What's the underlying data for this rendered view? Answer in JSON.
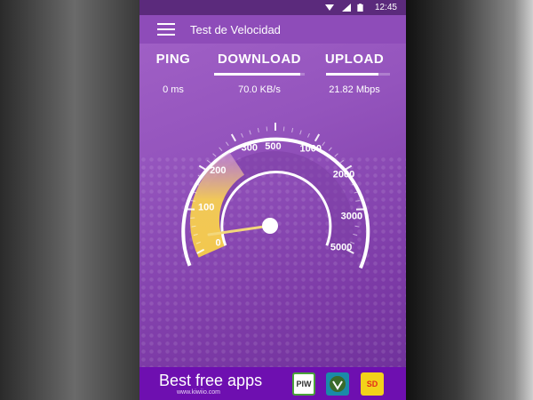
{
  "status_bar": {
    "time": "12:45",
    "icons": [
      "wifi-icon",
      "signal-icon",
      "battery-icon"
    ]
  },
  "app_bar": {
    "title": "Test de Velocidad",
    "menu_icon": "hamburger-menu-icon"
  },
  "tabs": [
    {
      "label": "PING",
      "value": "0 ms",
      "active": false
    },
    {
      "label": "DOWNLOAD",
      "value": "70.0 KB/s",
      "active": true,
      "progress": 0.95
    },
    {
      "label": "UPLOAD",
      "value": "21.82 Mbps",
      "active": true,
      "progress": 0.82
    }
  ],
  "gauge": {
    "ticks": [
      "0",
      "100",
      "200",
      "300",
      "500",
      "1000",
      "2000",
      "3000",
      "5000"
    ],
    "needle_value": 110,
    "colors": {
      "fill": "#f0c24a",
      "fill_fade": "#c98ad8",
      "needle": "#f3d77a",
      "ring": "#ffffff"
    }
  },
  "ad": {
    "title_pre": "Best ",
    "title_post": "free apps",
    "subtitle": "www.kiwiio.com",
    "apps": [
      {
        "label": "PIW",
        "name": "piw-app-icon"
      },
      {
        "label": "",
        "name": "kiwi-app-icon"
      },
      {
        "label": "SD",
        "name": "sd-app-icon"
      }
    ]
  }
}
